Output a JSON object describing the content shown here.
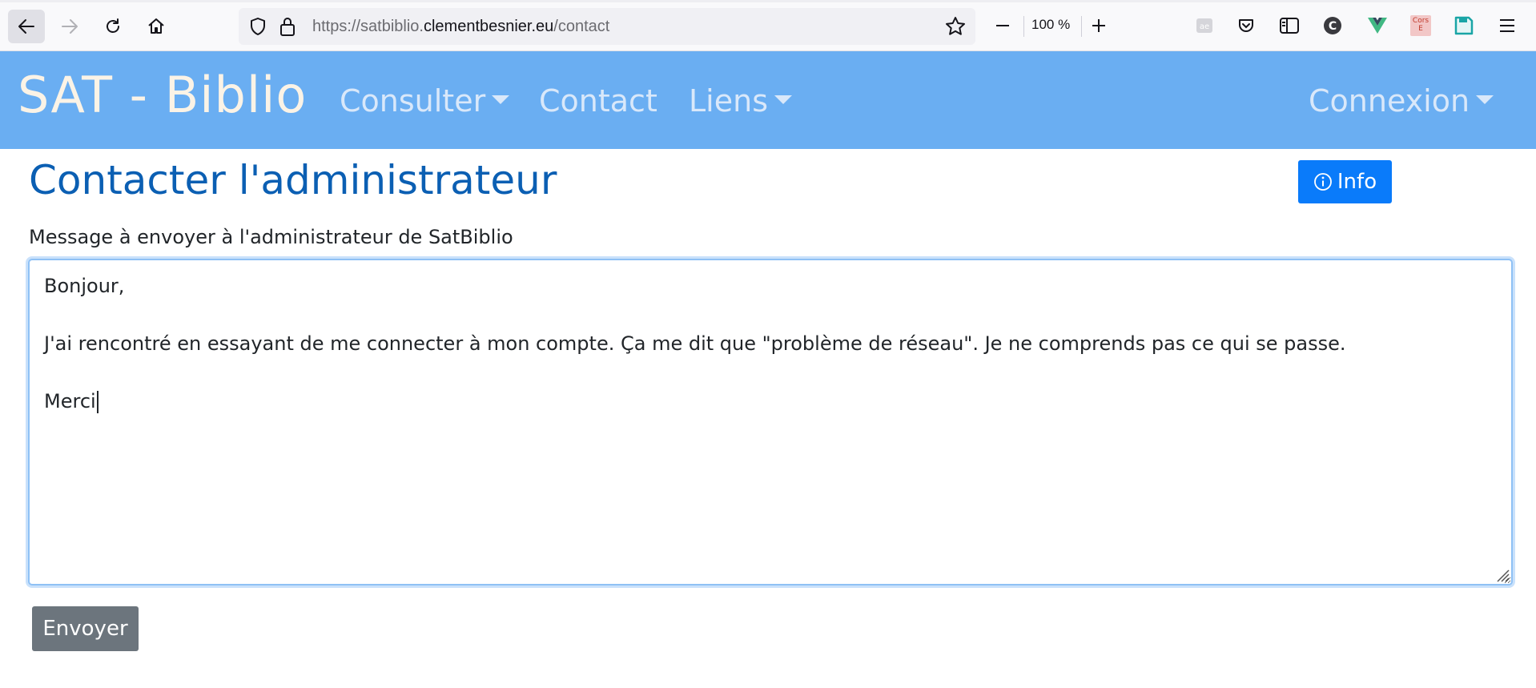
{
  "browser": {
    "url_prefix": "https://satbiblio.",
    "url_domain": "clementbesnier.eu",
    "url_path": "/contact",
    "zoom": "100 %",
    "extension_cors_label": "Cors E"
  },
  "navbar": {
    "brand": "SAT - Biblio",
    "items": [
      {
        "label": "Consulter",
        "dropdown": true
      },
      {
        "label": "Contact",
        "dropdown": false
      },
      {
        "label": "Liens",
        "dropdown": true
      }
    ],
    "login": {
      "label": "Connexion",
      "dropdown": true
    },
    "background_color": "#6aaef2"
  },
  "main": {
    "title": "Contacter l'administrateur",
    "info_button": "Info",
    "message_label": "Message à envoyer à l'administrateur de SatBiblio",
    "message_lines": [
      "Bonjour,",
      "",
      "J'ai rencontré en essayant de me connecter à mon compte. Ça me dit que \"problème de réseau\". Je ne comprends pas ce qui se passe.",
      "",
      "Merci"
    ],
    "send_button": "Envoyer"
  }
}
